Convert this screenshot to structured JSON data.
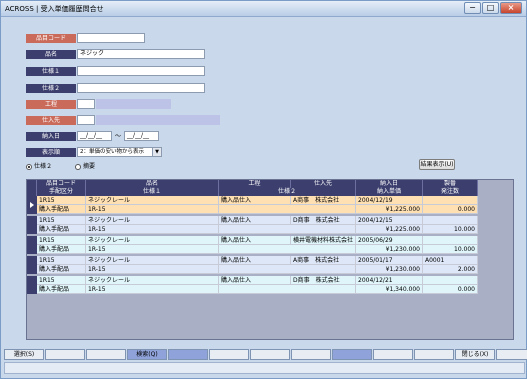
{
  "window": {
    "title": "ACROSS | 受入単価履歴問合せ",
    "min_symbol": "−",
    "max_symbol": "□",
    "close_symbol": "×"
  },
  "form": {
    "item_code_label": "品目コード",
    "item_code_value": "",
    "item_name_label": "品名",
    "item_name_value": "ネジック",
    "spec1_label": "仕様１",
    "spec1_value": "",
    "spec2_label": "仕様２",
    "spec2_value": "",
    "process_label": "工程",
    "process_value": "",
    "supplier_label": "仕入先",
    "supplier_value": "",
    "delivery_date_label": "納入日",
    "date_from": "__/__/__",
    "date_sep": "～",
    "date_to": "__/__/__",
    "display_order_label": "表示順",
    "display_order_value": "2：単価の安い物から表示",
    "radio_spec2": "仕様２",
    "radio_remarks": "摘要",
    "show_results_button": "結果表示(U)"
  },
  "grid": {
    "header_row1": [
      "品目コード",
      "品名",
      "工程",
      "仕入先",
      "納入日",
      "製番"
    ],
    "header_row2": [
      "手配区分",
      "仕様１",
      "仕様２",
      "納入単価",
      "発注数"
    ],
    "rows": [
      {
        "code": "1R15",
        "name": "ネジックレール",
        "process": "購入品仕入",
        "supplier": "A商事　株式会社",
        "date": "2004/12/19",
        "lot": "",
        "kubun": "購入手配品",
        "spec1": "1R-15",
        "spec2": "",
        "price": "¥1,225.000",
        "qty": "0.000",
        "bg": "#ffe0b3",
        "selected": true
      },
      {
        "code": "1R15",
        "name": "ネジックレール",
        "process": "購入品仕入",
        "supplier": "D商事　株式会社",
        "date": "2004/12/15",
        "lot": "",
        "kubun": "購入手配品",
        "spec1": "1R-15",
        "spec2": "",
        "price": "¥1,225.000",
        "qty": "10.000",
        "bg": "#dde7f7",
        "selected": false
      },
      {
        "code": "1R15",
        "name": "ネジックレール",
        "process": "購入品仕入",
        "supplier": "横井電機材料株式会社",
        "date": "2005/06/29",
        "lot": "",
        "kubun": "購入手配品",
        "spec1": "1R-15",
        "spec2": "",
        "price": "¥1,230.000",
        "qty": "10.000",
        "bg": "#dff5fa",
        "selected": false
      },
      {
        "code": "1R15",
        "name": "ネジックレール",
        "process": "購入品仕入",
        "supplier": "A商事　株式会社",
        "date": "2005/01/17",
        "lot": "A0001",
        "kubun": "購入手配品",
        "spec1": "1R-15",
        "spec2": "",
        "price": "¥1,230.000",
        "qty": "2.000",
        "bg": "#dde7f7",
        "selected": false
      },
      {
        "code": "1R15",
        "name": "ネジックレール",
        "process": "購入品仕入",
        "supplier": "D商事　株式会社",
        "date": "2004/12/21",
        "lot": "",
        "kubun": "購入手配品",
        "spec1": "1R-15",
        "spec2": "",
        "price": "¥1,340.000",
        "qty": "0.000",
        "bg": "#dff5fa",
        "selected": false
      }
    ]
  },
  "fkeys": [
    "選択(S)",
    "",
    "",
    "検索(Q)",
    "",
    "",
    "",
    "",
    "",
    "",
    "",
    "閉じる(X)",
    ""
  ]
}
